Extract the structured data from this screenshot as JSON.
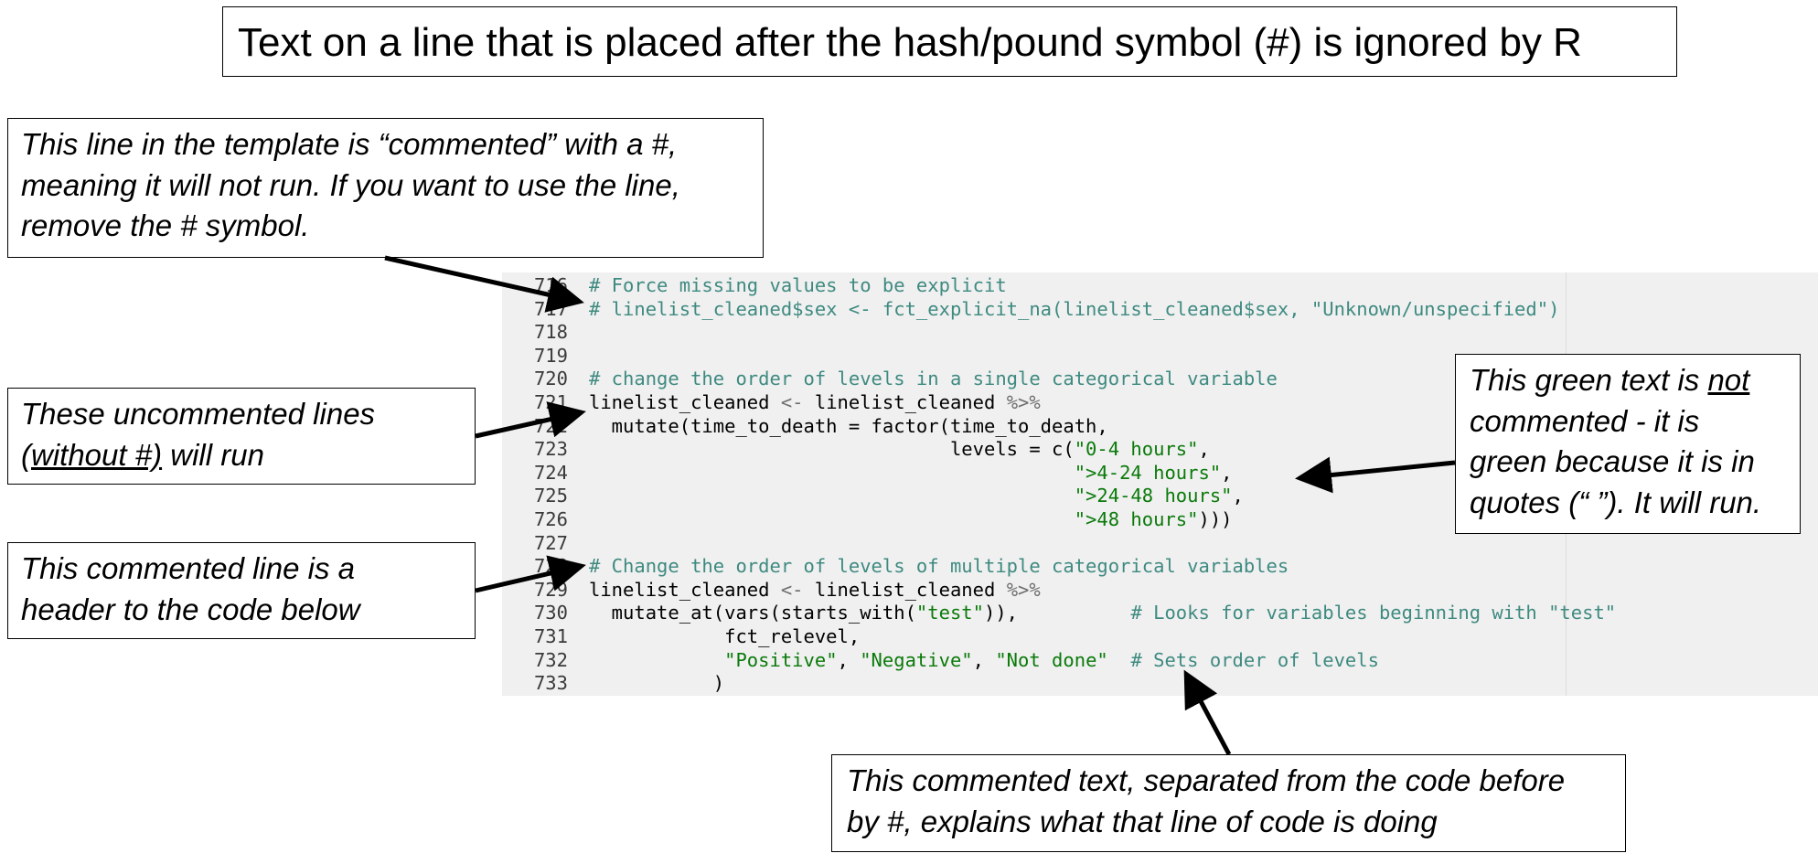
{
  "title": "Text on a line that is placed after the hash/pound symbol (#) is ignored by R",
  "notes": {
    "top_left": {
      "lines": [
        "This line in the template is “commented” with a #,",
        "meaning it will not run. If you want to use the line,",
        "remove the # symbol."
      ]
    },
    "uncommented": {
      "line1": "These uncommented lines",
      "line2_open": "(",
      "line2_underlined": "without #)",
      "line2_rest": " will run"
    },
    "header": {
      "lines": [
        "This commented line is a",
        "header to the code below"
      ]
    },
    "green_text": {
      "line1_pre": "This green text is ",
      "line1_underlined": "not",
      "lines": [
        "commented - it is",
        "green because it is in",
        "quotes (“ ”). It will run."
      ]
    },
    "bottom": {
      "lines": [
        "This commented text, separated from the code before",
        "by #, explains what that line of code is doing"
      ]
    }
  },
  "code": {
    "lines": [
      {
        "n": "716",
        "parts": [
          {
            "t": "# Force missing values to be explicit",
            "c": "cmt"
          }
        ]
      },
      {
        "n": "717",
        "parts": [
          {
            "t": "# linelist_cleaned$sex <- fct_explicit_na(linelist_cleaned$sex, \"Unknown/unspecified\")",
            "c": "cmt"
          }
        ]
      },
      {
        "n": "718",
        "parts": []
      },
      {
        "n": "719",
        "parts": []
      },
      {
        "n": "720",
        "parts": [
          {
            "t": "# change the order of levels in a single categorical variable",
            "c": "cmt"
          }
        ]
      },
      {
        "n": "721",
        "parts": [
          {
            "t": "linelist_cleaned ",
            "c": ""
          },
          {
            "t": "<-",
            "c": "op"
          },
          {
            "t": " linelist_cleaned ",
            "c": ""
          },
          {
            "t": "%>%",
            "c": "op"
          }
        ]
      },
      {
        "n": "722",
        "parts": [
          {
            "t": "  mutate(time_to_death = factor(time_to_death,",
            "c": ""
          }
        ]
      },
      {
        "n": "723",
        "parts": [
          {
            "t": "                                levels = c(",
            "c": ""
          },
          {
            "t": "\"0-4 hours\"",
            "c": "str"
          },
          {
            "t": ",",
            "c": ""
          }
        ]
      },
      {
        "n": "724",
        "parts": [
          {
            "t": "                                           ",
            "c": ""
          },
          {
            "t": "\">4-24 hours\"",
            "c": "str"
          },
          {
            "t": ",",
            "c": ""
          }
        ]
      },
      {
        "n": "725",
        "parts": [
          {
            "t": "                                           ",
            "c": ""
          },
          {
            "t": "\">24-48 hours\"",
            "c": "str"
          },
          {
            "t": ",",
            "c": ""
          }
        ]
      },
      {
        "n": "726",
        "parts": [
          {
            "t": "                                           ",
            "c": ""
          },
          {
            "t": "\">48 hours\"",
            "c": "str"
          },
          {
            "t": ")))",
            "c": ""
          }
        ]
      },
      {
        "n": "727",
        "parts": []
      },
      {
        "n": "728",
        "parts": [
          {
            "t": "# Change the order of levels of multiple categorical variables",
            "c": "cmt"
          }
        ]
      },
      {
        "n": "729",
        "parts": [
          {
            "t": "linelist_cleaned ",
            "c": ""
          },
          {
            "t": "<-",
            "c": "op"
          },
          {
            "t": " linelist_cleaned ",
            "c": ""
          },
          {
            "t": "%>%",
            "c": "op"
          }
        ]
      },
      {
        "n": "730",
        "parts": [
          {
            "t": "  mutate_at(vars(starts_with(",
            "c": ""
          },
          {
            "t": "\"test\"",
            "c": "str"
          },
          {
            "t": ")),          ",
            "c": ""
          },
          {
            "t": "# Looks for variables beginning with \"test\"",
            "c": "cmt"
          }
        ]
      },
      {
        "n": "731",
        "parts": [
          {
            "t": "            fct_relevel,",
            "c": ""
          }
        ]
      },
      {
        "n": "732",
        "parts": [
          {
            "t": "            ",
            "c": ""
          },
          {
            "t": "\"Positive\"",
            "c": "str"
          },
          {
            "t": ", ",
            "c": ""
          },
          {
            "t": "\"Negative\"",
            "c": "str"
          },
          {
            "t": ", ",
            "c": ""
          },
          {
            "t": "\"Not done\"",
            "c": "str"
          },
          {
            "t": "  ",
            "c": ""
          },
          {
            "t": "# Sets order of levels",
            "c": "cmt"
          }
        ]
      },
      {
        "n": "733",
        "parts": [
          {
            "t": "           )",
            "c": ""
          }
        ]
      }
    ]
  }
}
